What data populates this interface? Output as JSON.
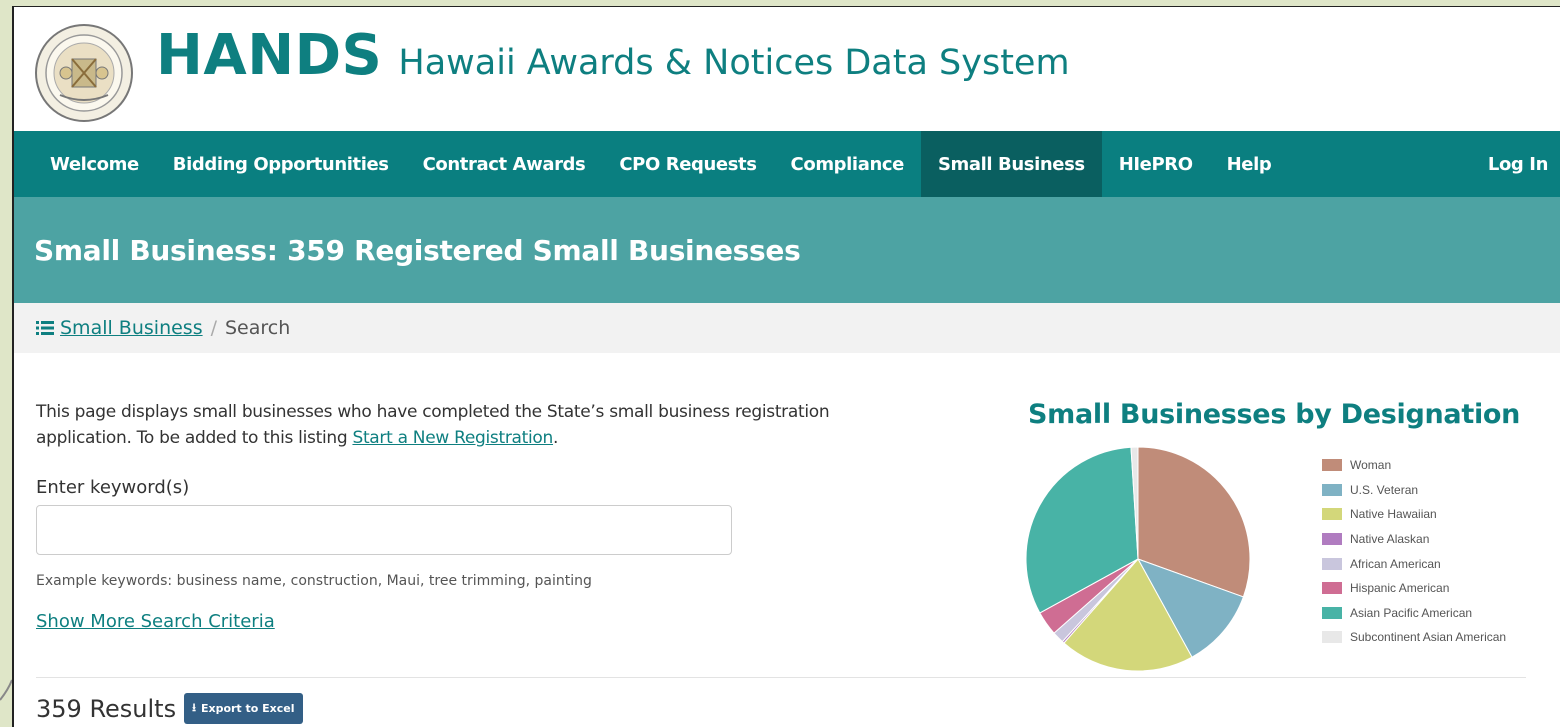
{
  "header": {
    "acronym": "HANDS",
    "full_name": "Hawaii Awards & Notices Data System"
  },
  "nav": {
    "items": [
      {
        "label": "Welcome",
        "active": false
      },
      {
        "label": "Bidding Opportunities",
        "active": false
      },
      {
        "label": "Contract Awards",
        "active": false
      },
      {
        "label": "CPO Requests",
        "active": false
      },
      {
        "label": "Compliance",
        "active": false
      },
      {
        "label": "Small Business",
        "active": true
      },
      {
        "label": "HIePRO",
        "active": false
      },
      {
        "label": "Help",
        "active": false
      }
    ],
    "login_label": "Log In"
  },
  "page_title": "Small Business: 359 Registered Small Businesses",
  "breadcrumb": {
    "link_label": "Small Business",
    "separator": "/",
    "current": "Search"
  },
  "intro": {
    "text_before": "This page displays small businesses who have completed the State’s small business registration application. To be added to this listing ",
    "link_label": "Start a New Registration",
    "text_after": "."
  },
  "search": {
    "label": "Enter keyword(s)",
    "value": "",
    "placeholder": "",
    "hint": "Example keywords: business name, construction, Maui, tree trimming, painting",
    "more_criteria_label": "Show More Search Criteria"
  },
  "results": {
    "count_label": "359 Results",
    "export_label": "Export to Excel"
  },
  "chart_data": {
    "type": "pie",
    "title": "Small Businesses by Designation",
    "legend_placement": "right",
    "slices": [
      {
        "label": "Woman",
        "value": 30.5,
        "color": "#c08c79"
      },
      {
        "label": "U.S. Veteran",
        "value": 11.5,
        "color": "#7fb2c4"
      },
      {
        "label": "Native Hawaiian",
        "value": 19.5,
        "color": "#d3d77a"
      },
      {
        "label": "Native Alaskan",
        "value": 0.3,
        "color": "#b07cc0"
      },
      {
        "label": "African American",
        "value": 1.7,
        "color": "#c9c6dd"
      },
      {
        "label": "Hispanic American",
        "value": 3.5,
        "color": "#cf6d93"
      },
      {
        "label": "Asian Pacific American",
        "value": 32.0,
        "color": "#48b3a6"
      },
      {
        "label": "Subcontinent Asian American",
        "value": 1.0,
        "color": "#e8e8e8"
      }
    ]
  }
}
